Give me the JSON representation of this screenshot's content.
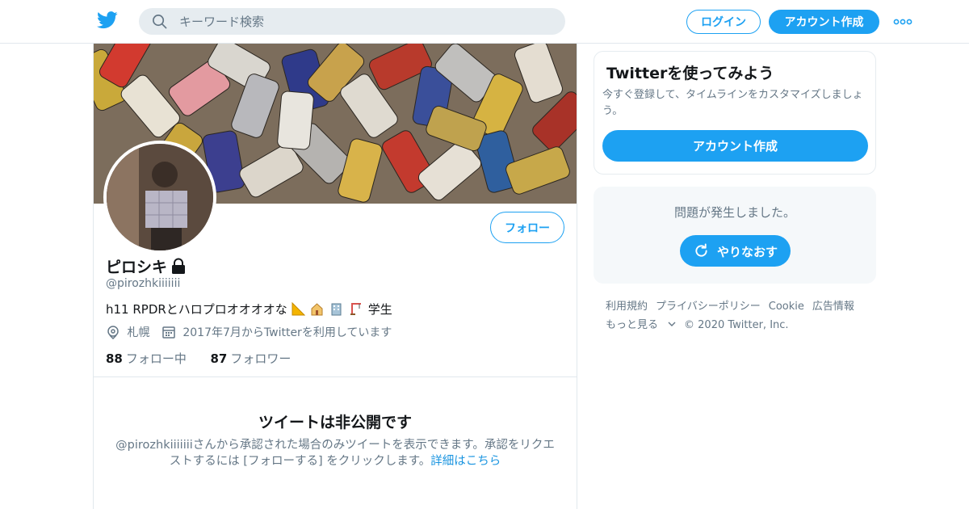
{
  "header": {
    "search_placeholder": "キーワード検索",
    "login_label": "ログイン",
    "signup_label": "アカウント作成",
    "icons": [
      "twitter-bird-icon",
      "search-icon",
      "more-icon"
    ],
    "accent_color": "#1da1f2"
  },
  "profile": {
    "follow_label": "フォロー",
    "name": "ピロシキ",
    "handle": "@pirozhkiiiiiii",
    "bio": "h11 RPDRとハロプロオオオオな",
    "bio_suffix": "学生",
    "location": "札幌",
    "joined": "2017年7月からTwitterを利用しています",
    "following_count": "88",
    "following_label": "フォロー中",
    "followers_count": "87",
    "followers_label": "フォロワー"
  },
  "protected": {
    "title": "ツイートは非公開です",
    "text": "@pirozhkiiiiiiiさんから承認された場合のみツイートを表示できます。承認をリクエストするには [フォローする] をクリックします。",
    "link": "詳細はこちら"
  },
  "signup_card": {
    "title": "Twitterを使ってみよう",
    "text": "今すぐ登録して、タイムラインをカスタマイズしましょう。",
    "button": "アカウント作成"
  },
  "error_box": {
    "text": "問題が発生しました。",
    "button": "やりなおす"
  },
  "footer": {
    "terms": "利用規約",
    "privacy": "プライバシーポリシー",
    "cookie": "Cookie",
    "ads": "広告情報",
    "more": "もっと見る",
    "copyright": "© 2020 Twitter, Inc."
  }
}
